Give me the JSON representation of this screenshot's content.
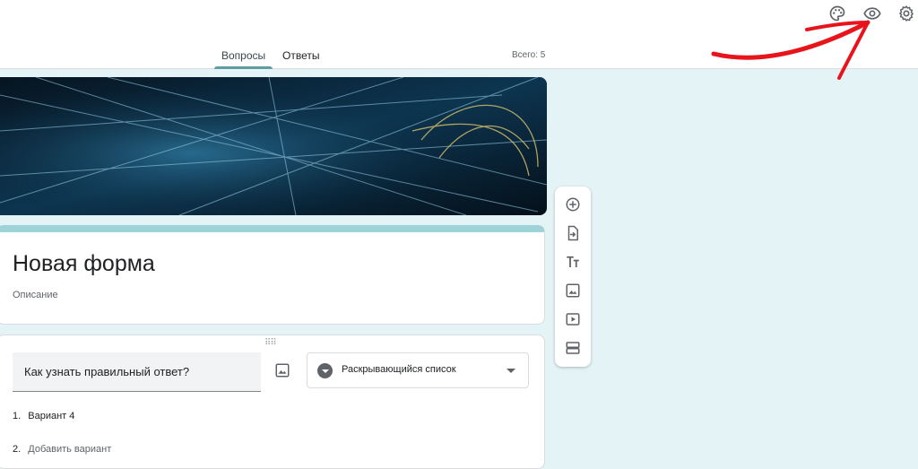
{
  "topbar": {
    "icons": [
      "palette-icon",
      "eye-icon",
      "gear-icon"
    ],
    "tabs": [
      {
        "label": "Вопросы",
        "active": true
      },
      {
        "label": "Ответы",
        "active": false
      }
    ],
    "total": "Всего: 5"
  },
  "form": {
    "title": "Новая форма",
    "description": "Описание",
    "accent_color": "#9fd3da"
  },
  "question": {
    "text": "Как узнать правильный ответ?",
    "type": "Раскрывающийся список",
    "options": [
      {
        "num": "1.",
        "label": "Вариант 4"
      },
      {
        "num": "2.",
        "label": "Добавить вариант"
      }
    ]
  },
  "toolbar": {
    "icons": [
      "add-question-icon",
      "import-questions-icon",
      "title-text-icon",
      "image-icon",
      "video-icon",
      "section-icon"
    ]
  },
  "colors": {
    "background": "#e4f3f5",
    "annotation_arrow": "#e8141c"
  }
}
